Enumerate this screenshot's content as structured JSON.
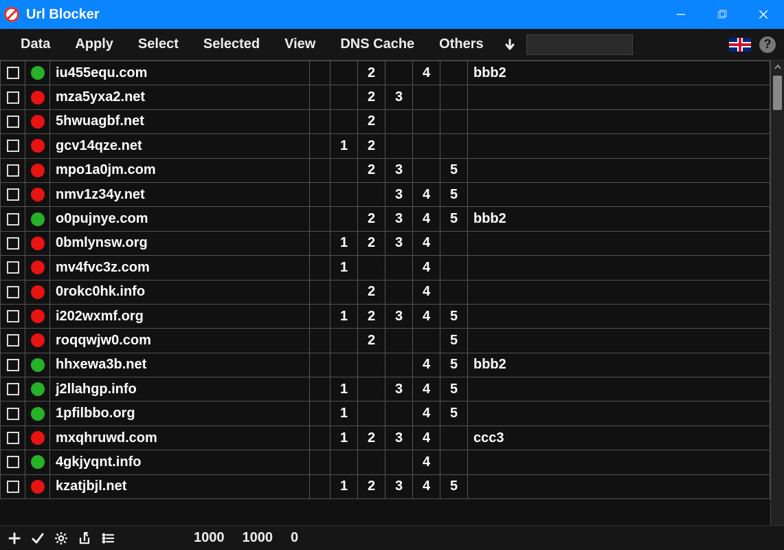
{
  "titlebar": {
    "title": "Url Blocker"
  },
  "menu": {
    "items": [
      "Data",
      "Apply",
      "Select",
      "Selected",
      "View",
      "DNS Cache",
      "Others"
    ],
    "search_value": ""
  },
  "rows": [
    {
      "checked": false,
      "status": "green",
      "url": "iu455equ.com",
      "c1": "",
      "c2": "2",
      "c3": "",
      "c4": "4",
      "c5": "",
      "note": "bbb2"
    },
    {
      "checked": false,
      "status": "red",
      "url": "mza5yxa2.net",
      "c1": "",
      "c2": "2",
      "c3": "3",
      "c4": "",
      "c5": "",
      "note": ""
    },
    {
      "checked": false,
      "status": "red",
      "url": "5hwuagbf.net",
      "c1": "",
      "c2": "2",
      "c3": "",
      "c4": "",
      "c5": "",
      "note": ""
    },
    {
      "checked": false,
      "status": "red",
      "url": "gcv14qze.net",
      "c1": "1",
      "c2": "2",
      "c3": "",
      "c4": "",
      "c5": "",
      "note": ""
    },
    {
      "checked": false,
      "status": "red",
      "url": "mpo1a0jm.com",
      "c1": "",
      "c2": "2",
      "c3": "3",
      "c4": "",
      "c5": "5",
      "note": ""
    },
    {
      "checked": false,
      "status": "red",
      "url": "nmv1z34y.net",
      "c1": "",
      "c2": "",
      "c3": "3",
      "c4": "4",
      "c5": "5",
      "note": ""
    },
    {
      "checked": false,
      "status": "green",
      "url": "o0pujnye.com",
      "c1": "",
      "c2": "2",
      "c3": "3",
      "c4": "4",
      "c5": "5",
      "note": "bbb2"
    },
    {
      "checked": false,
      "status": "red",
      "url": "0bmlynsw.org",
      "c1": "1",
      "c2": "2",
      "c3": "3",
      "c4": "4",
      "c5": "",
      "note": ""
    },
    {
      "checked": false,
      "status": "red",
      "url": "mv4fvc3z.com",
      "c1": "1",
      "c2": "",
      "c3": "",
      "c4": "4",
      "c5": "",
      "note": ""
    },
    {
      "checked": false,
      "status": "red",
      "url": "0rokc0hk.info",
      "c1": "",
      "c2": "2",
      "c3": "",
      "c4": "4",
      "c5": "",
      "note": ""
    },
    {
      "checked": false,
      "status": "red",
      "url": "i202wxmf.org",
      "c1": "1",
      "c2": "2",
      "c3": "3",
      "c4": "4",
      "c5": "5",
      "note": ""
    },
    {
      "checked": false,
      "status": "red",
      "url": "roqqwjw0.com",
      "c1": "",
      "c2": "2",
      "c3": "",
      "c4": "",
      "c5": "5",
      "note": ""
    },
    {
      "checked": false,
      "status": "green",
      "url": "hhxewa3b.net",
      "c1": "",
      "c2": "",
      "c3": "",
      "c4": "4",
      "c5": "5",
      "note": "bbb2"
    },
    {
      "checked": false,
      "status": "green",
      "url": "j2llahgp.info",
      "c1": "1",
      "c2": "",
      "c3": "3",
      "c4": "4",
      "c5": "5",
      "note": ""
    },
    {
      "checked": false,
      "status": "green",
      "url": "1pfilbbo.org",
      "c1": "1",
      "c2": "",
      "c3": "",
      "c4": "4",
      "c5": "5",
      "note": ""
    },
    {
      "checked": false,
      "status": "red",
      "url": "mxqhruwd.com",
      "c1": "1",
      "c2": "2",
      "c3": "3",
      "c4": "4",
      "c5": "",
      "note": "ccc3"
    },
    {
      "checked": false,
      "status": "green",
      "url": "4gkjyqnt.info",
      "c1": "",
      "c2": "",
      "c3": "",
      "c4": "4",
      "c5": "",
      "note": ""
    },
    {
      "checked": false,
      "status": "red",
      "url": "kzatjbjl.net",
      "c1": "1",
      "c2": "2",
      "c3": "3",
      "c4": "4",
      "c5": "5",
      "note": ""
    }
  ],
  "statusbar": {
    "count_total": "1000",
    "count_filtered": "1000",
    "count_selected": "0"
  }
}
